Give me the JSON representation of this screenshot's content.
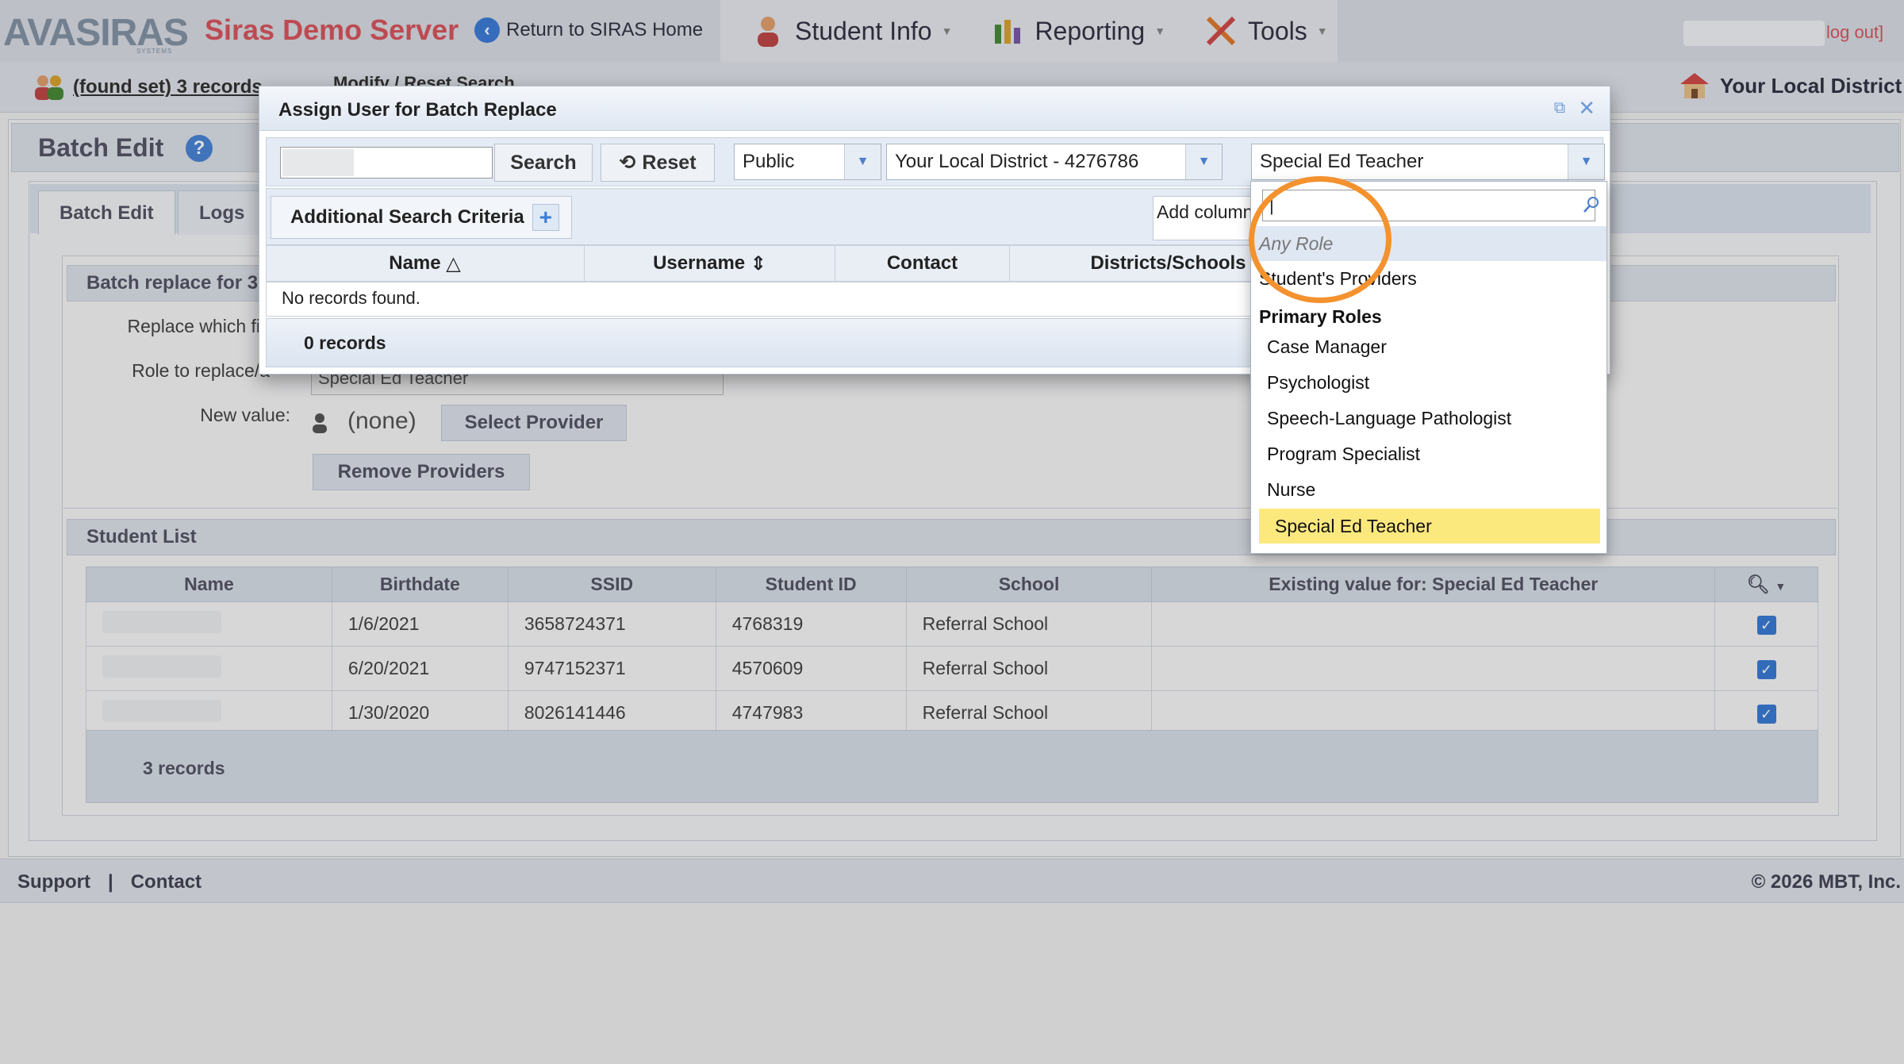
{
  "header": {
    "logo_text": "AVASIRAS",
    "logo_sub": "SYSTEMS",
    "server_name": "Siras Demo Server",
    "return_home": "Return to SIRAS Home",
    "nav": [
      {
        "label": "Student Info",
        "icon": "student-icon"
      },
      {
        "label": "Reporting",
        "icon": "reporting-icon"
      },
      {
        "label": "Tools",
        "icon": "tools-icon"
      }
    ],
    "logout": "log out]"
  },
  "subbar": {
    "found_set": "(found set) 3 records",
    "partial_text": "Modify / Reset Search",
    "district": "Your Local District"
  },
  "page": {
    "title": "Batch Edit",
    "help": "?",
    "tabs": [
      "Batch Edit",
      "Logs"
    ],
    "batch_section": "Batch replace for 3",
    "labels": {
      "replace_which": "Replace which fi",
      "role": "Role to replace/a",
      "new_value": "New value:"
    },
    "role_value": "Special Ed Teacher",
    "new_value_text": "(none)",
    "select_provider": "Select Provider",
    "remove_providers": "Remove Providers",
    "student_list_title": "Student List",
    "student_columns": [
      "Name",
      "Birthdate",
      "SSID",
      "Student ID",
      "School",
      "Existing value for: Special Ed Teacher"
    ],
    "students": [
      {
        "birthdate": "1/6/2021",
        "ssid": "3658724371",
        "student_id": "4768319",
        "school": "Referral School"
      },
      {
        "birthdate": "6/20/2021",
        "ssid": "9747152371",
        "student_id": "4570609",
        "school": "Referral School"
      },
      {
        "birthdate": "1/30/2020",
        "ssid": "8026141446",
        "student_id": "4747983",
        "school": "Referral School"
      }
    ],
    "records": "3 records"
  },
  "footer": {
    "support": "Support",
    "sep": "|",
    "contact": "Contact",
    "copyright": "© 2026 MBT, Inc."
  },
  "modal": {
    "title": "Assign User for Batch Replace",
    "search_button": "Search",
    "reset_button": "Reset",
    "scope": "Public",
    "district": "Your Local District - 4276786",
    "role": "Special Ed Teacher",
    "additional_criteria": "Additional Search Criteria",
    "add_column": "Add column",
    "columns": [
      "Name",
      "Username",
      "Contact",
      "Districts/Schools"
    ],
    "no_records": "No records found.",
    "records": "0 records"
  },
  "dropdown": {
    "search_value": "|",
    "any_role": "Any Role",
    "students_providers": "Student's Providers",
    "group_label": "Primary Roles",
    "roles": [
      "Case Manager",
      "Psychologist",
      "Speech-Language Pathologist",
      "Program Specialist",
      "Nurse",
      "Special Ed Teacher"
    ],
    "selected": "Special Ed Teacher"
  },
  "colors": {
    "accent": "#3a7bd5",
    "server_name": "#d9555f",
    "highlight_ring": "#f3922e",
    "selected_item": "#fce97e"
  }
}
